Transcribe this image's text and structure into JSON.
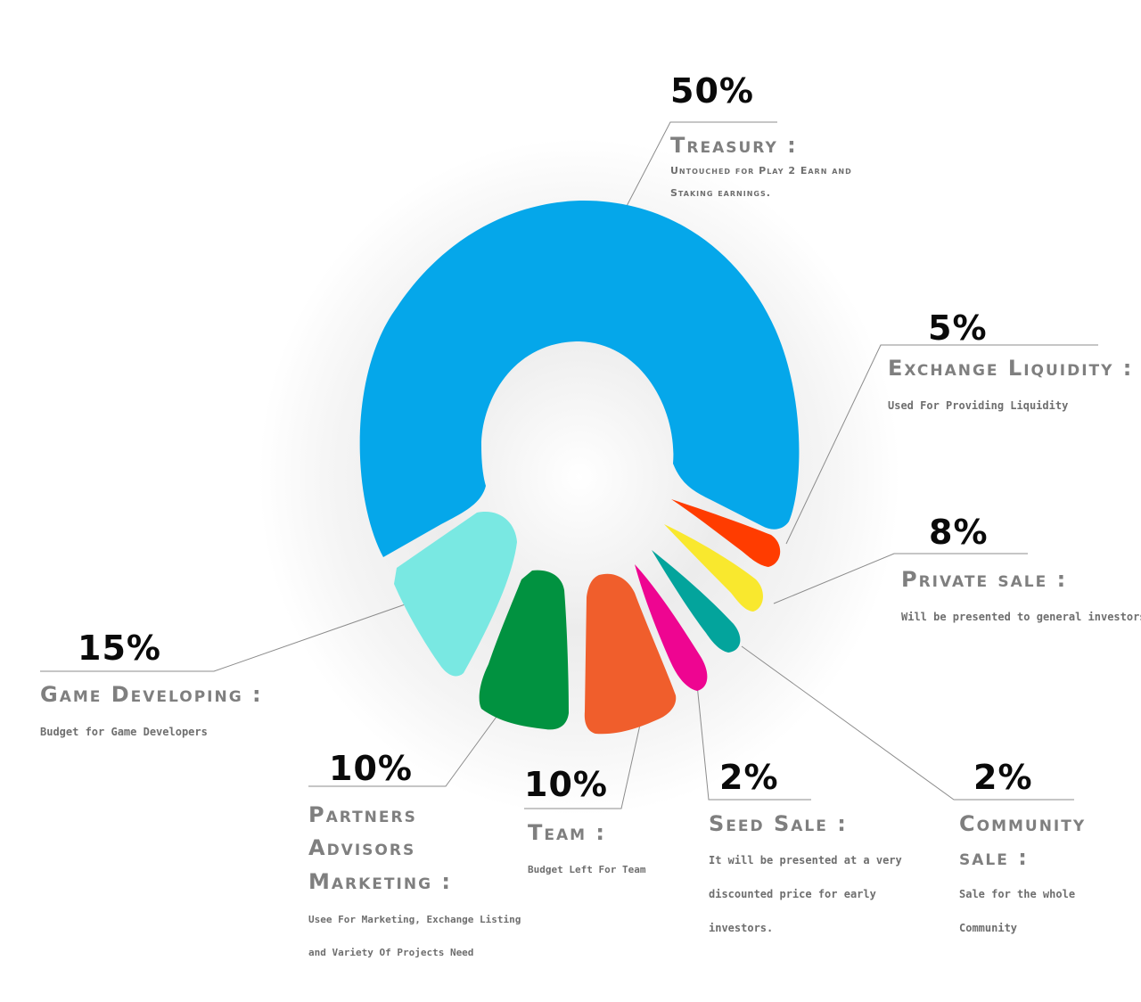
{
  "chart_data": {
    "type": "pie",
    "title": "",
    "slices": [
      {
        "key": "treasury",
        "value": 50,
        "pct_label": "50%",
        "title": "Treasury :",
        "desc_lines": [
          "Untouched for Play 2 Earn and",
          "Staking earnings."
        ],
        "color": "#05a7ea"
      },
      {
        "key": "exchange",
        "value": 5,
        "pct_label": "5%",
        "title": "Exchange Liquidity :",
        "desc_lines": [
          "Used For Providing Liquidity"
        ],
        "color": "#ff3c00"
      },
      {
        "key": "private",
        "value": 8,
        "pct_label": "8%",
        "title": "Private sale :",
        "desc_lines": [
          "Will be presented to general investors"
        ],
        "color": "#f9e82e"
      },
      {
        "key": "community",
        "value": 2,
        "pct_label": "2%",
        "title_lines": [
          "Community",
          "sale :"
        ],
        "desc_lines": [
          "Sale for the whole",
          "Community"
        ],
        "color": "#03a49c"
      },
      {
        "key": "seed",
        "value": 2,
        "pct_label": "2%",
        "title": "Seed Sale :",
        "desc_lines": [
          "It will be presented at a very",
          "discounted price for early",
          "investors."
        ],
        "color": "#ee0591"
      },
      {
        "key": "team",
        "value": 10,
        "pct_label": "10%",
        "title": "Team :",
        "desc_lines": [
          "Budget Left For Team"
        ],
        "color": "#f05e2c"
      },
      {
        "key": "partners",
        "value": 10,
        "pct_label": "10%",
        "title_lines": [
          "Partners",
          "Advisors",
          "Marketing :"
        ],
        "desc_lines": [
          "Usee For Marketing, Exchange Listing",
          "and Variety Of Projects Need"
        ],
        "color": "#019240"
      },
      {
        "key": "game",
        "value": 15,
        "pct_label": "15%",
        "title": "Game Developing :",
        "desc_lines": [
          "Budget for Game Developers"
        ],
        "color": "#79e8e2"
      }
    ]
  }
}
